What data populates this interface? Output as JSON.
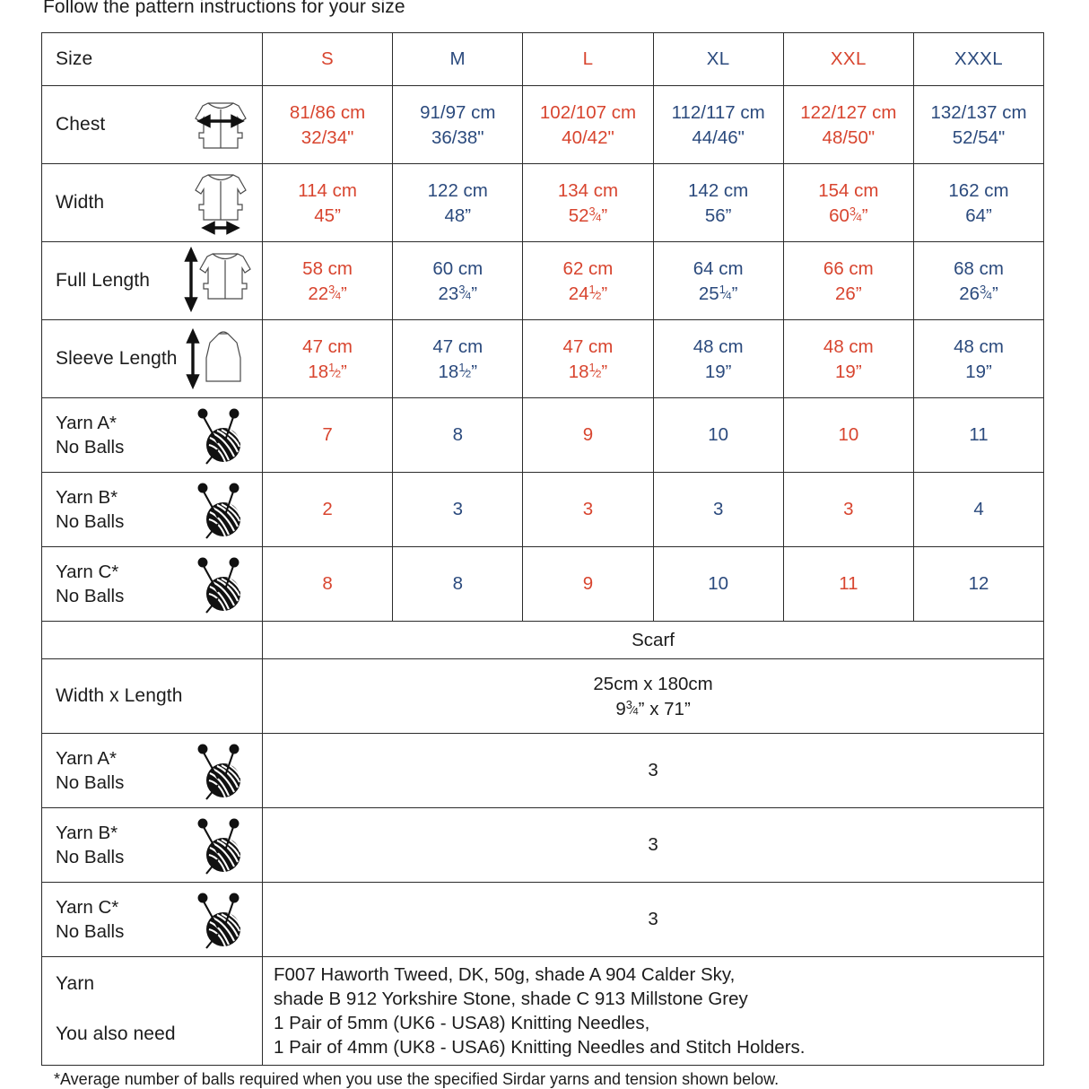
{
  "intro_text": "Follow the pattern instructions for your size",
  "colors": {
    "red": "#d8452f",
    "blue": "#2b4a7d",
    "black": "#1c1c1c",
    "border": "#2b2b2b"
  },
  "table": {
    "row_label_header": "Size",
    "sizes": [
      {
        "label": "S",
        "color": "red"
      },
      {
        "label": "M",
        "color": "blue"
      },
      {
        "label": "L",
        "color": "red"
      },
      {
        "label": "XL",
        "color": "blue"
      },
      {
        "label": "XXL",
        "color": "red"
      },
      {
        "label": "XXXL",
        "color": "blue"
      }
    ],
    "rows": [
      {
        "label": "Chest",
        "icon": "sweater-chest-icon",
        "cm": [
          "81/86 cm",
          "91/97 cm",
          "102/107 cm",
          "112/117 cm",
          "122/127 cm",
          "132/137 cm"
        ],
        "inch": [
          "32/34\"",
          "36/38\"",
          "40/42\"",
          "44/46\"",
          "48/50\"",
          "52/54\""
        ]
      },
      {
        "label": "Width",
        "icon": "sweater-width-icon",
        "cm": [
          "114 cm",
          "122 cm",
          "134 cm",
          "142 cm",
          "154 cm",
          "162 cm"
        ],
        "inch": [
          "45\"",
          "48\"",
          "52¾\"",
          "56\"",
          "60¾\"",
          "64\""
        ]
      },
      {
        "label": "Full Length",
        "icon": "sweater-length-icon",
        "cm": [
          "58 cm",
          "60 cm",
          "62 cm",
          "64 cm",
          "66 cm",
          "68 cm"
        ],
        "inch": [
          "22¾\"",
          "23¾\"",
          "24½\"",
          "25¼\"",
          "26\"",
          "26¾\""
        ]
      },
      {
        "label": "Sleeve Length",
        "icon": "sleeve-icon",
        "cm": [
          "47 cm",
          "47 cm",
          "47 cm",
          "48 cm",
          "48 cm",
          "48 cm"
        ],
        "inch": [
          "18½\"",
          "18½\"",
          "18½\"",
          "19\"",
          "19\"",
          "19\""
        ]
      }
    ],
    "yarn_rows": [
      {
        "label_line1": "Yarn A*",
        "label_line2": "No Balls",
        "icon": "yarn-ball-icon",
        "values": [
          "7",
          "8",
          "9",
          "10",
          "10",
          "11"
        ]
      },
      {
        "label_line1": "Yarn B*",
        "label_line2": "No Balls",
        "icon": "yarn-ball-icon",
        "values": [
          "2",
          "3",
          "3",
          "3",
          "3",
          "4"
        ]
      },
      {
        "label_line1": "Yarn C*",
        "label_line2": "No Balls",
        "icon": "yarn-ball-icon",
        "values": [
          "8",
          "8",
          "9",
          "10",
          "11",
          "12"
        ]
      }
    ],
    "scarf": {
      "header": "Scarf",
      "width_length_label": "Width x Length",
      "width_length_cm": "25cm x 180cm",
      "width_length_inch": "9¾\" x 71\"",
      "yarn_rows": [
        {
          "label_line1": "Yarn A*",
          "label_line2": "No Balls",
          "icon": "yarn-ball-icon",
          "value": "3"
        },
        {
          "label_line1": "Yarn B*",
          "label_line2": "No Balls",
          "icon": "yarn-ball-icon",
          "value": "3"
        },
        {
          "label_line1": "Yarn C*",
          "label_line2": "No Balls",
          "icon": "yarn-ball-icon",
          "value": "3"
        }
      ]
    },
    "materials": {
      "label_yarn": "Yarn",
      "label_also_need": "You also need",
      "lines": [
        "F007 Haworth Tweed, DK, 50g, shade A 904 Calder Sky,",
        "shade B 912 Yorkshire Stone, shade C 913 Millstone Grey",
        "1 Pair of 5mm (UK6 - USA8) Knitting Needles,",
        "1 Pair of 4mm (UK8 - USA6) Knitting Needles and Stitch Holders."
      ]
    }
  },
  "footnote": "*Average number of balls required when you use the specified Sirdar yarns and tension shown below."
}
